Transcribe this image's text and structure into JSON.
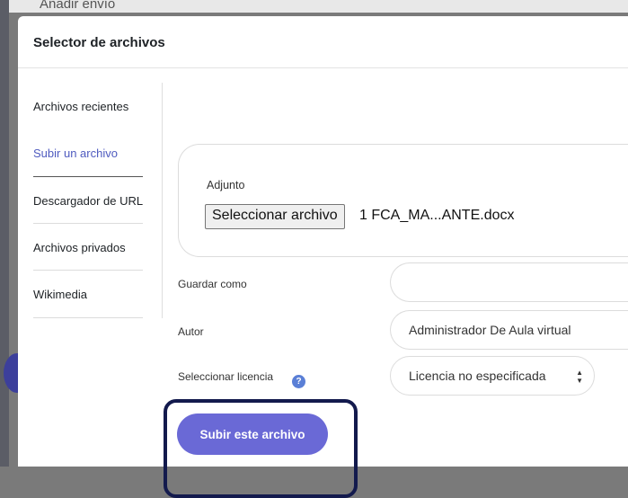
{
  "background": {
    "title": "Añadir envío"
  },
  "dialog": {
    "title": "Selector de archivos"
  },
  "sidebar": {
    "items": [
      {
        "label": "Archivos recientes",
        "active": false
      },
      {
        "label": "Subir un archivo",
        "active": true
      },
      {
        "label": "Descargador de URL",
        "active": false
      },
      {
        "label": "Archivos privados",
        "active": false
      },
      {
        "label": "Wikimedia",
        "active": false
      }
    ]
  },
  "upload": {
    "attachment_label": "Adjunto",
    "choose_button": "Seleccionar archivo",
    "selected_file": "1 FCA_MA...ANTE.docx"
  },
  "form": {
    "save_as_label": "Guardar como",
    "save_as_value": "",
    "author_label": "Autor",
    "author_value": "Administrador De Aula virtual",
    "license_label": "Seleccionar licencia",
    "license_value": "Licencia no especificada",
    "help_icon": "?"
  },
  "actions": {
    "submit_label": "Subir este archivo"
  },
  "colors": {
    "accent": "#6a69d6",
    "active_link": "#4f5bbf",
    "highlight_border": "#131a4d"
  }
}
